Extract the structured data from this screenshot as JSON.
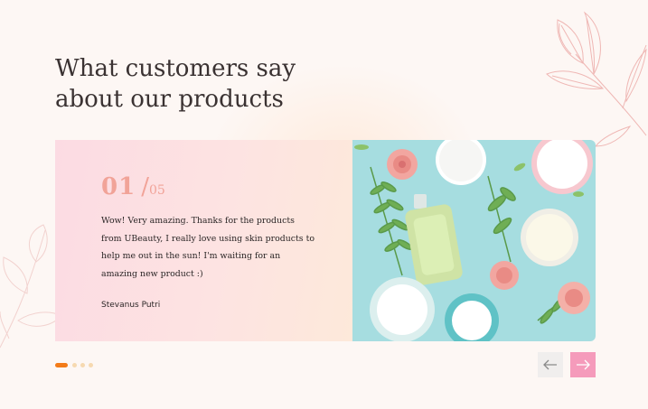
{
  "section": {
    "title": "What customers say about our products"
  },
  "testimonial": {
    "current": "01",
    "separator": "/",
    "total": "05",
    "quote": "Wow! Very amazing. Thanks for the products from UBeauty, I really love using skin products to help me out in the sun! I'm waiting for an amazing new product :)",
    "author": "Stevanus Putri"
  },
  "pagination": {
    "dots": 4,
    "active_index": 0
  },
  "icons": {
    "prev": "arrow-left-icon",
    "next": "arrow-right-icon",
    "decoration": "leaf-outline-icon"
  },
  "colors": {
    "background": "#fdf7f4",
    "accent_orange": "#f37b18",
    "accent_pink": "#f59bbb",
    "counter": "#f1a398",
    "heading": "#3a3232"
  }
}
